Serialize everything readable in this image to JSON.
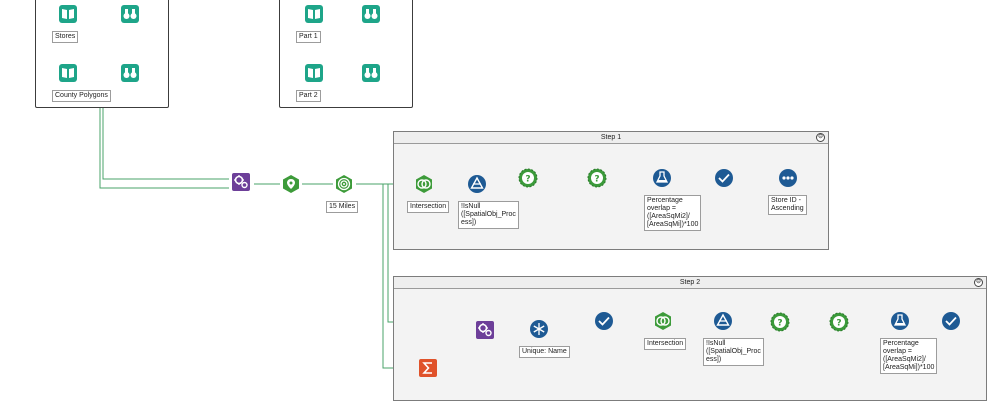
{
  "canvas": {
    "background": "#ffffff",
    "wire_color": "#4aa36a"
  },
  "colors": {
    "input_teal": "#1ea589",
    "browse_teal": "#1ea589",
    "join_purple": "#6d3f99",
    "spatial_green": "#3d9b3a",
    "formula_blue": "#1e5a94",
    "filter_green": "#3b9a3a",
    "sum_orange": "#e0522a"
  },
  "groups": [
    {
      "labels": [
        "Stores",
        "County Polygons"
      ]
    },
    {
      "labels": [
        "Part 1",
        "Part 2"
      ]
    }
  ],
  "step1": {
    "title": "Step 1",
    "collapse_symbol": "⊖",
    "labels": {
      "intersection": "Intersection",
      "filter": "!IsNull\n([SpatialObj_Proc\ness])",
      "formula": "Percentage\noverlap =\n([AreaSqMi2]/\n[AreaSqMi])*100",
      "sort": "Store ID -\nAscending"
    }
  },
  "step2": {
    "title": "Step 2",
    "collapse_symbol": "⊖",
    "labels": {
      "unique": "Unique: Name",
      "intersection": "Intersection",
      "filter": "!IsNull\n([SpatialObj_Proc\ness])",
      "formula": "Percentage\noverlap =\n([AreaSqMi2]/\n[AreaSqMi])*100"
    }
  },
  "main": {
    "buffer_label": "15 Miles"
  }
}
